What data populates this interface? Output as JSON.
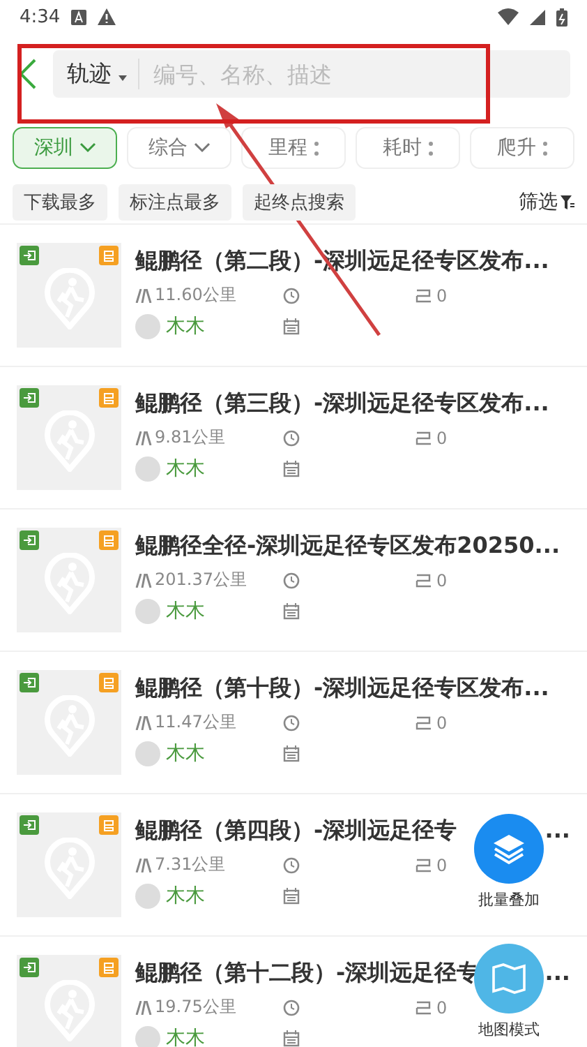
{
  "status_bar": {
    "time": "4:34"
  },
  "search": {
    "scope": "轨迹",
    "placeholder": "编号、名称、描述"
  },
  "filters": [
    {
      "label": "深圳",
      "selected": true,
      "kind": "dropdown"
    },
    {
      "label": "综合",
      "selected": false,
      "kind": "dropdown"
    },
    {
      "label": "里程",
      "selected": false,
      "kind": "sort"
    },
    {
      "label": "耗时",
      "selected": false,
      "kind": "sort"
    },
    {
      "label": "爬升",
      "selected": false,
      "kind": "sort"
    }
  ],
  "quick_tags": [
    "下载最多",
    "标注点最多",
    "起终点搜索"
  ],
  "filter_button": "筛选",
  "tracks": [
    {
      "title": "鲲鹏径（第二段）-深圳远足径专区发布...",
      "distance": "11.60公里",
      "count": "0",
      "author": "木木"
    },
    {
      "title": "鲲鹏径（第三段）-深圳远足径专区发布...",
      "distance": "9.81公里",
      "count": "0",
      "author": "木木"
    },
    {
      "title": "鲲鹏径全径-深圳远足径专区发布20250...",
      "distance": "201.37公里",
      "count": "0",
      "author": "木木"
    },
    {
      "title": "鲲鹏径（第十段）-深圳远足径专区发布...",
      "distance": "11.47公里",
      "count": "0",
      "author": "木木"
    },
    {
      "title": "鲲鹏径（第四段）-深圳远足径专",
      "tail": "...",
      "distance": "7.31公里",
      "count": "0",
      "author": "木木"
    },
    {
      "title": "鲲鹏径（第十二段）-深圳远足径专",
      "tail": "...",
      "distance": "19.75公里",
      "count": "0",
      "author": "木木"
    }
  ],
  "fabs": [
    {
      "label": "批量叠加",
      "kind": "layers"
    },
    {
      "label": "地图模式",
      "kind": "map"
    }
  ]
}
